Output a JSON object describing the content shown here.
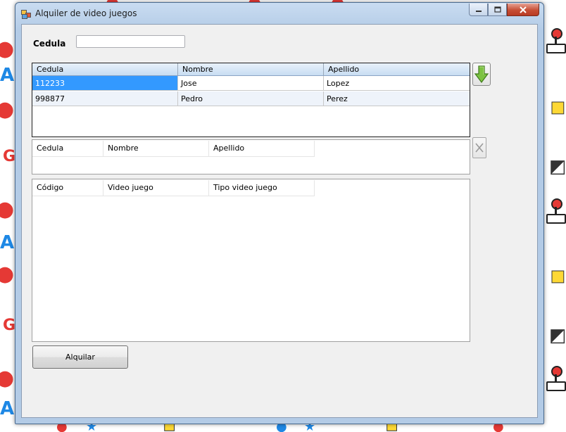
{
  "window": {
    "title": "Alquiler de video juegos",
    "app_icon": "app-icon",
    "controls": [
      "minimize-icon",
      "maximize-icon",
      "close-icon"
    ]
  },
  "form": {
    "cedula_label": "Cedula",
    "cedula_value": ""
  },
  "clients_table": {
    "columns": [
      "Cedula",
      "Nombre",
      "Apellido"
    ],
    "rows": [
      {
        "cedula": "112233",
        "nombre": "Jose",
        "apellido": "Lopez"
      },
      {
        "cedula": "998877",
        "nombre": "Pedro",
        "apellido": "Perez"
      }
    ],
    "selected_row": 0
  },
  "selected_client_table": {
    "columns": [
      "Cedula",
      "Nombre",
      "Apellido"
    ],
    "rows": []
  },
  "games_table": {
    "columns": [
      "Código",
      "Video juego",
      "Tipo video juego"
    ],
    "rows": []
  },
  "buttons": {
    "move_down_icon": "arrow-down-icon",
    "remove_icon": "x-icon",
    "alquilar_label": "Alquilar"
  },
  "colors": {
    "selection": "#3399ff",
    "arrow": "#7cc242",
    "close_button": "#c74f35"
  }
}
